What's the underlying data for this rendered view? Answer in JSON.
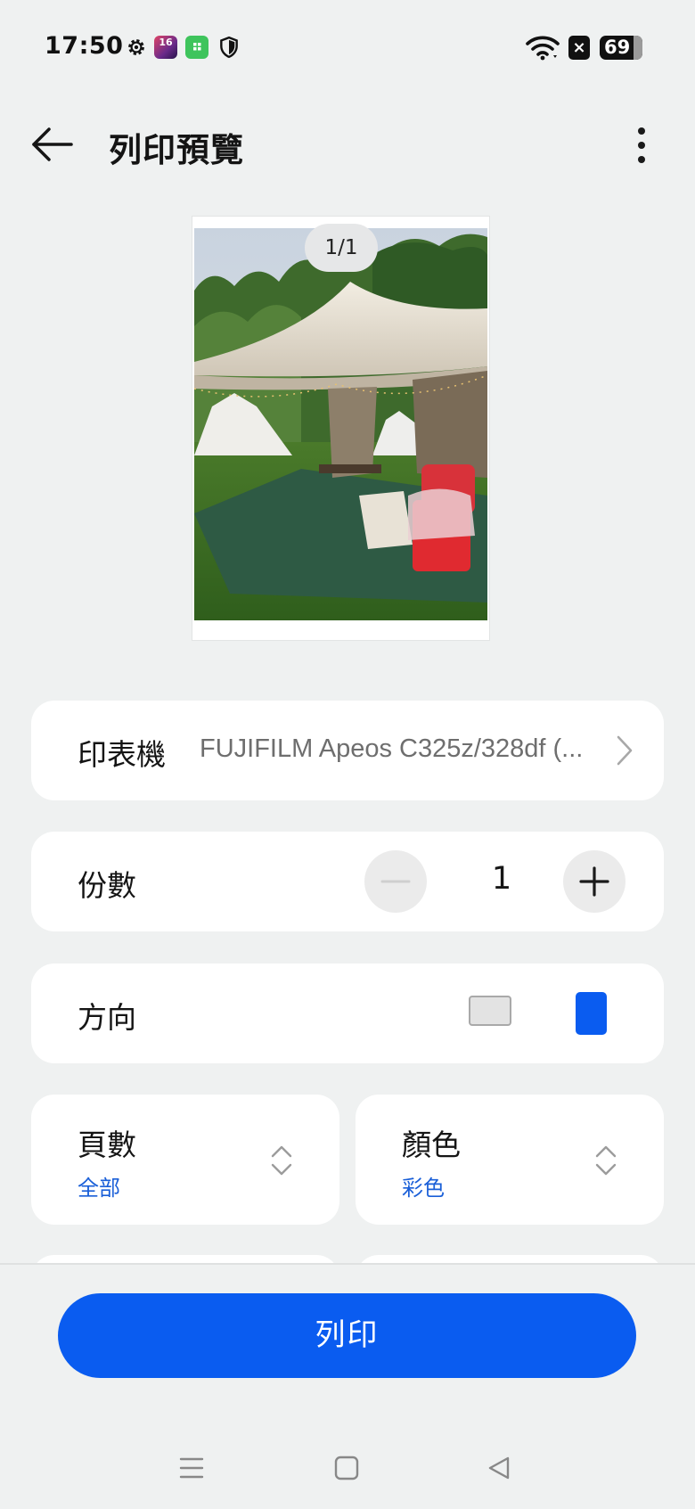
{
  "status_bar": {
    "time": "17:50",
    "notification_badge": "16",
    "battery_level": "69",
    "icons": [
      "gear-icon",
      "app-16-icon",
      "app-green-icon",
      "shield-icon",
      "wifi-icon",
      "close-box-icon",
      "battery-icon"
    ]
  },
  "app_bar": {
    "title": "列印預覽",
    "back_icon": "arrow-left-icon",
    "more_icon": "more-vertical-icon"
  },
  "preview": {
    "page_indicator": "1/1",
    "image_alt": "camping tent photo"
  },
  "settings": {
    "printer": {
      "label": "印表機",
      "value": "FUJIFILM Apeos C325z/328df (..."
    },
    "copies": {
      "label": "份數",
      "value": "1"
    },
    "orientation": {
      "label": "方向",
      "options": [
        "landscape",
        "portrait"
      ],
      "selected": "portrait"
    },
    "pages": {
      "label": "頁數",
      "value": "全部"
    },
    "color": {
      "label": "顏色",
      "value": "彩色"
    }
  },
  "actions": {
    "print_label": "列印"
  },
  "colors": {
    "accent": "#0a5cf0",
    "link_blue": "#1a5fd8",
    "background": "#eff1f1",
    "card": "#ffffff"
  },
  "nav_bar": {
    "icons": [
      "menu-icon",
      "home-icon",
      "back-triangle-icon"
    ]
  }
}
